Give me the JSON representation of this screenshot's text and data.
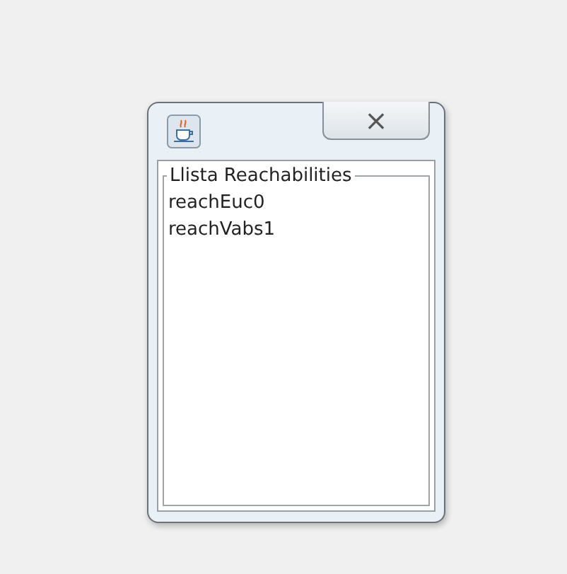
{
  "window": {
    "close_button": "⨯"
  },
  "group": {
    "title": "Llista Reachabilities",
    "items": [
      {
        "label": "reachEuc0",
        "selected": false
      },
      {
        "label": "reachVabs1",
        "selected": false
      }
    ]
  }
}
